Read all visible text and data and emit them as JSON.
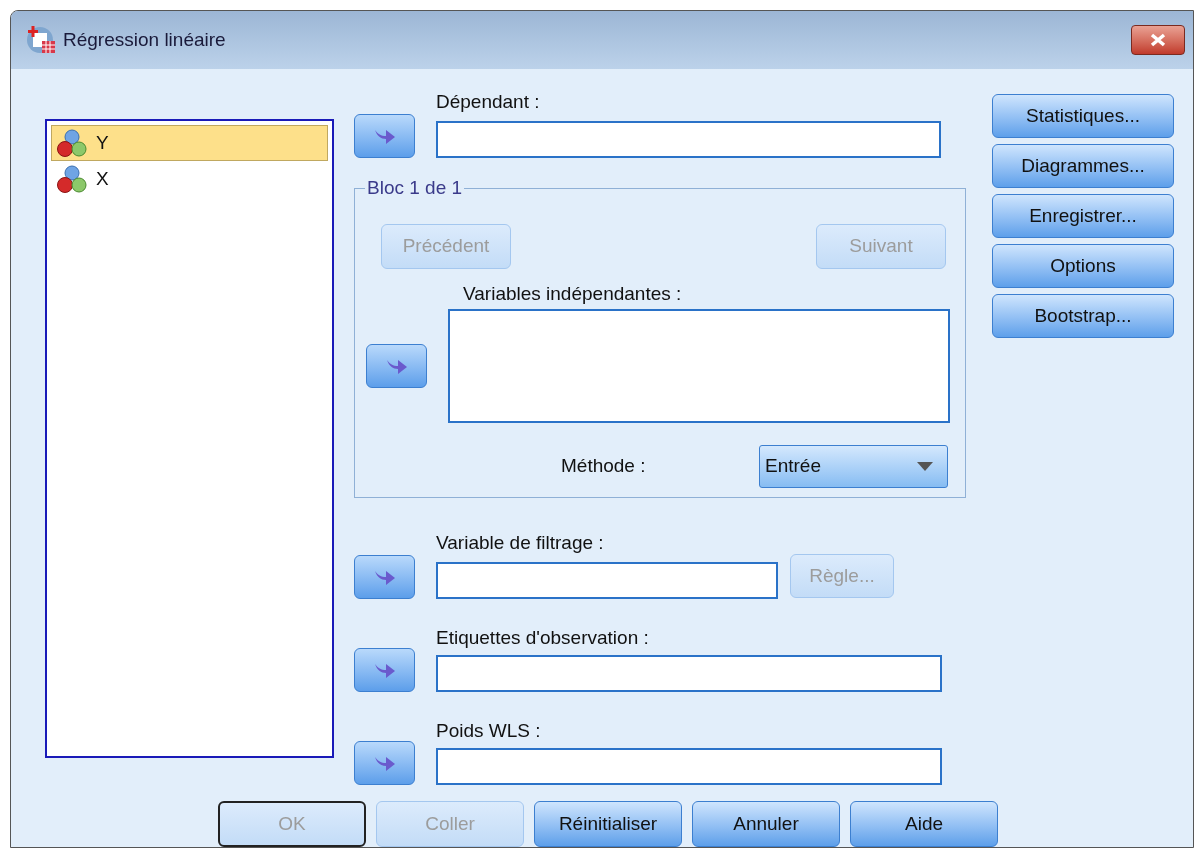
{
  "window": {
    "title": "Régression linéaire"
  },
  "variables": [
    {
      "name": "Y",
      "selected": true
    },
    {
      "name": "X",
      "selected": false
    }
  ],
  "dependent": {
    "label": "Dépendant :"
  },
  "block": {
    "title": "Bloc 1 de 1",
    "previous": {
      "label": "Précédent",
      "disabled": true
    },
    "next": {
      "label": "Suivant",
      "disabled": true
    },
    "independent": {
      "label": "Variables indépendantes :"
    },
    "method": {
      "label": "Méthode :",
      "value": "Entrée"
    }
  },
  "selection": {
    "label": "Variable de filtrage :",
    "rule_button": {
      "label": "Règle...",
      "disabled": true
    }
  },
  "case_labels": {
    "label": "Etiquettes d'observation :"
  },
  "wls_weight": {
    "label": "Poids WLS :"
  },
  "side_buttons": [
    {
      "label": "Statistiques...",
      "disabled": false
    },
    {
      "label": "Diagrammes...",
      "disabled": false
    },
    {
      "label": "Enregistrer...",
      "disabled": false
    },
    {
      "label": "Options",
      "disabled": false
    },
    {
      "label": "Bootstrap...",
      "disabled": false
    }
  ],
  "buttons": [
    {
      "label": "OK",
      "disabled": true,
      "default": true
    },
    {
      "label": "Coller",
      "disabled": true,
      "default": false
    },
    {
      "label": "Réinitialiser",
      "disabled": false,
      "default": false
    },
    {
      "label": "Annuler",
      "disabled": false,
      "default": false
    },
    {
      "label": "Aide",
      "disabled": false,
      "default": false
    }
  ]
}
